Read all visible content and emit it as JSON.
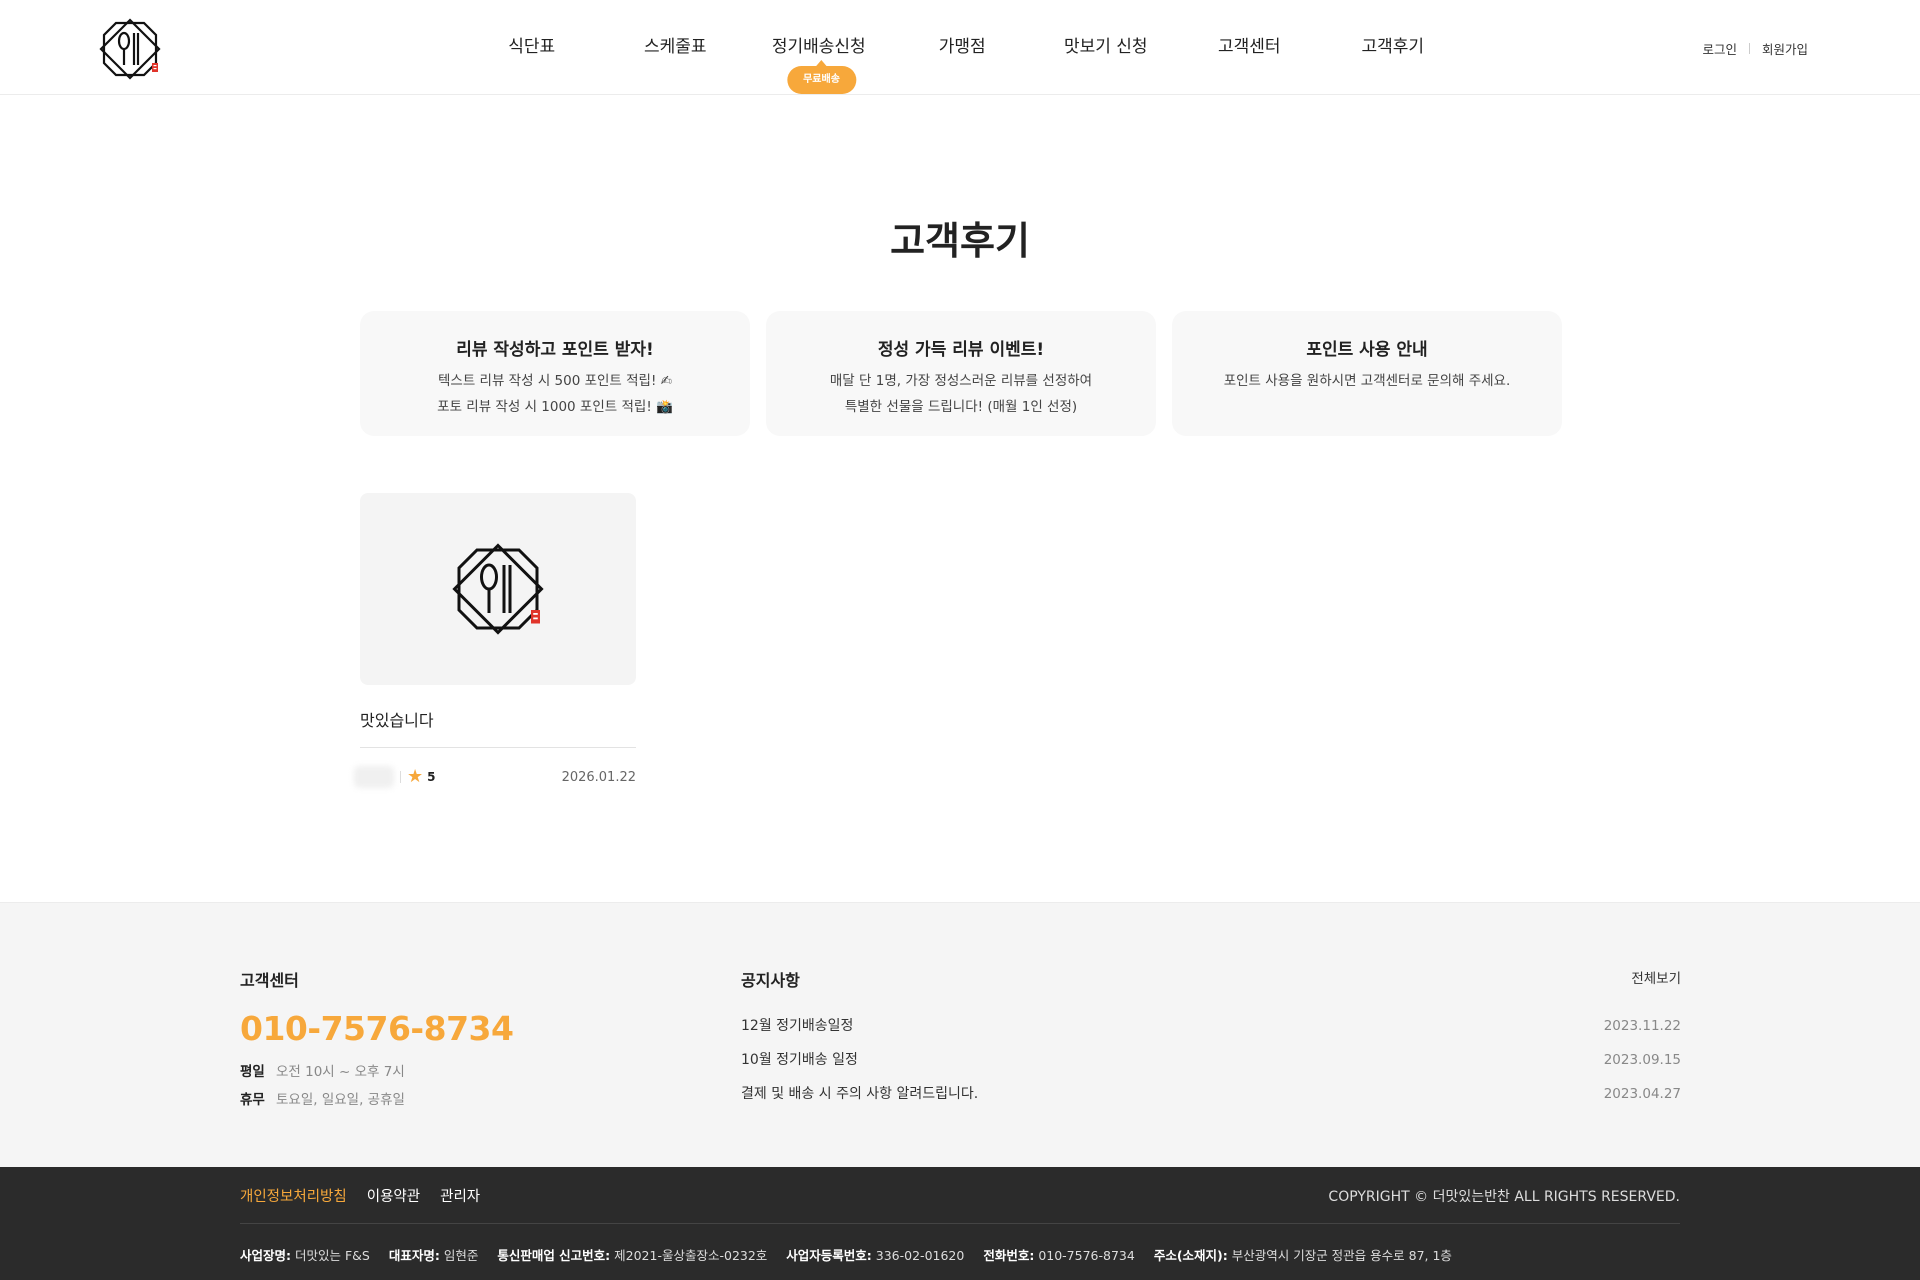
{
  "header": {
    "nav": [
      {
        "label": "식단표"
      },
      {
        "label": "스케줄표"
      },
      {
        "label": "정기배송신청",
        "badge": "무료배송"
      },
      {
        "label": "가맹점"
      },
      {
        "label": "맛보기 신청"
      },
      {
        "label": "고객센터"
      },
      {
        "label": "고객후기"
      }
    ],
    "login": "로그인",
    "signup": "회원가입"
  },
  "page_title": "고객후기",
  "cards": [
    {
      "title": "리뷰 작성하고 포인트 받자!",
      "lines": [
        "텍스트 리뷰 작성 시 500 포인트 적립! ✍",
        "포토 리뷰 작성 시 1000 포인트 적립! 📸"
      ]
    },
    {
      "title": "정성 가득 리뷰 이벤트!",
      "lines": [
        "매달 단 1명, 가장 정성스러운 리뷰를 선정하여",
        "특별한 선물을 드립니다! (매월 1인 선정)"
      ]
    },
    {
      "title": "포인트 사용 안내",
      "lines": [
        "포인트 사용을 원하시면 고객센터로 문의해 주세요."
      ]
    }
  ],
  "reviews": [
    {
      "title": "맛있습니다",
      "rating": "5",
      "date": "2026.01.22"
    }
  ],
  "footer": {
    "cs": {
      "heading": "고객센터",
      "phone": "010-7576-8734",
      "weekday_key": "평일",
      "weekday_val": "오전 10시 ~ 오후 7시",
      "holiday_key": "휴무",
      "holiday_val": "토요일, 일요일, 공휴일"
    },
    "notice": {
      "heading": "공지사항",
      "view_all": "전체보기",
      "items": [
        {
          "title": "12월 정기배송일정",
          "date": "2023.11.22"
        },
        {
          "title": "10월 정기배송 일정",
          "date": "2023.09.15"
        },
        {
          "title": "결제 및 배송 시 주의 사항 알려드립니다.",
          "date": "2023.04.27"
        }
      ]
    },
    "links": [
      "개인정보처리방침",
      "이용약관",
      "관리자"
    ],
    "copyright": "COPYRIGHT © 더맛있는반찬 ALL RIGHTS RESERVED.",
    "info": [
      {
        "key": "사업장명:",
        "val": "더맛있는 F&S"
      },
      {
        "key": "대표자명:",
        "val": "임현준"
      },
      {
        "key": "통신판매업 신고번호:",
        "val": "제2021-울상출장소-0232호"
      },
      {
        "key": "사업자등록번호:",
        "val": "336-02-01620"
      },
      {
        "key": "전화번호:",
        "val": "010-7576-8734"
      },
      {
        "key": "주소(소재지):",
        "val": "부산광역시 기장군 정관읍 용수로 87, 1층"
      }
    ]
  },
  "colors": {
    "accent": "#f7a83b",
    "footer_dark": "#2b2b2b",
    "logo_red": "#e0342a"
  }
}
